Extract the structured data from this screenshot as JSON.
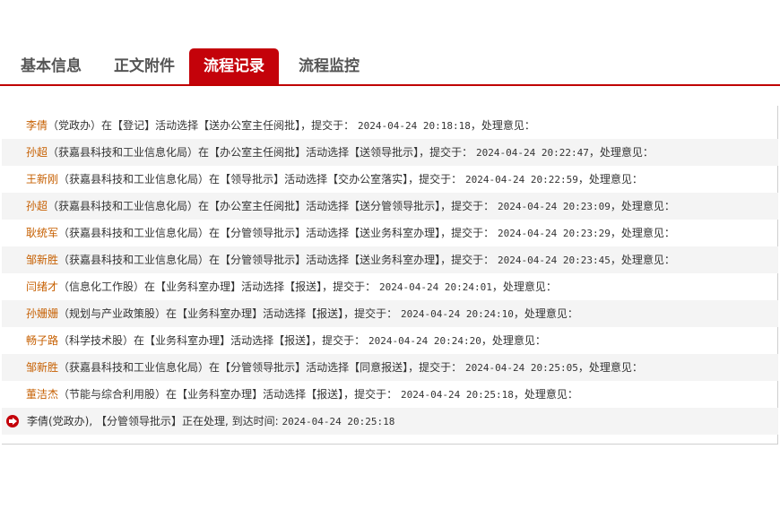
{
  "tabs": [
    "基本信息",
    "正文附件",
    "流程记录",
    "流程监控"
  ],
  "records": [
    {
      "name": "李倩",
      "dept": "（党政办）",
      "from": "登记",
      "to": "送办公室主任阅批",
      "time": "2024-04-24 20:18:18"
    },
    {
      "name": "孙超",
      "dept": "（获嘉县科技和工业信息化局）",
      "from": "办公室主任阅批",
      "to": "送领导批示",
      "time": "2024-04-24 20:22:47"
    },
    {
      "name": "王新刚",
      "dept": "（获嘉县科技和工业信息化局）",
      "from": "领导批示",
      "to": "交办公室落实",
      "time": "2024-04-24 20:22:59"
    },
    {
      "name": "孙超",
      "dept": "（获嘉县科技和工业信息化局）",
      "from": "办公室主任阅批",
      "to": "送分管领导批示",
      "time": "2024-04-24 20:23:09"
    },
    {
      "name": "耿统军",
      "dept": "（获嘉县科技和工业信息化局）",
      "from": "分管领导批示",
      "to": "送业务科室办理",
      "time": "2024-04-24 20:23:29"
    },
    {
      "name": "邹新胜",
      "dept": "（获嘉县科技和工业信息化局）",
      "from": "分管领导批示",
      "to": "送业务科室办理",
      "time": "2024-04-24 20:23:45"
    },
    {
      "name": "闫绪才",
      "dept": "（信息化工作股）",
      "from": "业务科室办理",
      "to": "报送",
      "time": "2024-04-24 20:24:01"
    },
    {
      "name": "孙姗姗",
      "dept": "（规划与产业政策股）",
      "from": "业务科室办理",
      "to": "报送",
      "time": "2024-04-24 20:24:10"
    },
    {
      "name": "畅子路",
      "dept": "（科学技术股）",
      "from": "业务科室办理",
      "to": "报送",
      "time": "2024-04-24 20:24:20"
    },
    {
      "name": "邹新胜",
      "dept": "（获嘉县科技和工业信息化局）",
      "from": "分管领导批示",
      "to": "同意报送",
      "time": "2024-04-24 20:25:05"
    },
    {
      "name": "董洁杰",
      "dept": "（节能与综合利用股）",
      "from": "业务科室办理",
      "to": "报送",
      "time": "2024-04-24 20:25:18"
    }
  ],
  "phrases": {
    "in": "在",
    "act": "活动选择",
    "submit": "，提交于：",
    "opinion": "，处理意见："
  },
  "current": {
    "text": "李倩(党政办), 【分管领导批示】正在处理, 到达时间:",
    "time": "2024-04-24 20:25:18",
    "icon": "arrow-right-circle-icon"
  },
  "colors": {
    "accent": "#c4020a",
    "name": "#c65f00"
  }
}
